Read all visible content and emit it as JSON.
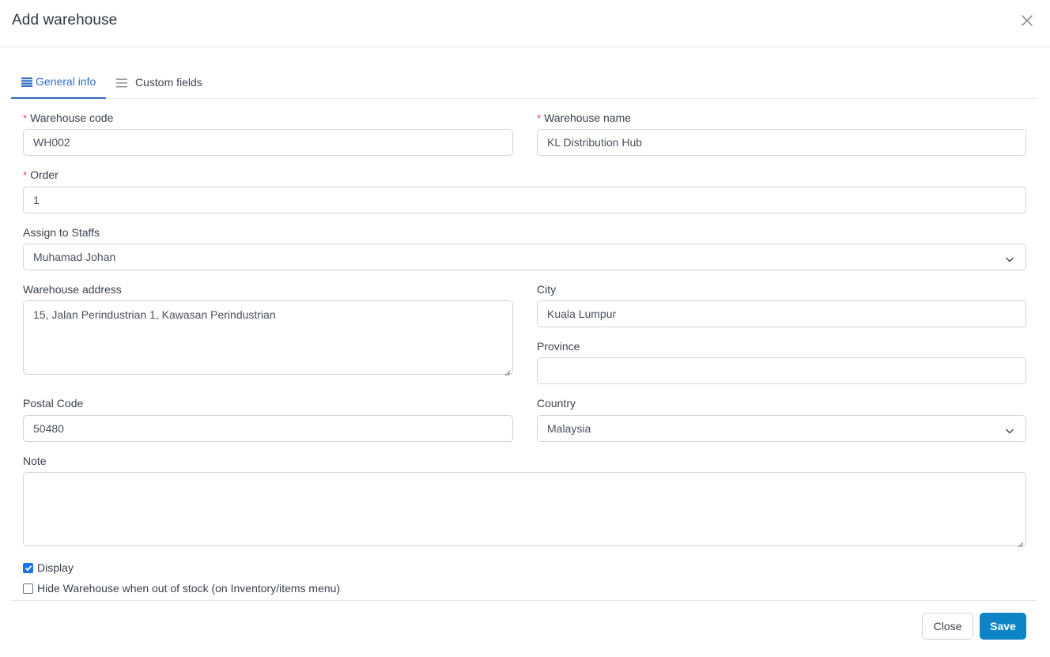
{
  "modal": {
    "title": "Add warehouse",
    "close_icon": "close-icon"
  },
  "tabs": [
    {
      "label": "General info",
      "icon": "list-icon",
      "active": true
    },
    {
      "label": "Custom fields",
      "icon": "bars-icon",
      "active": false
    }
  ],
  "form": {
    "warehouse_code": {
      "label": "Warehouse code",
      "required": "*",
      "value": "WH002"
    },
    "warehouse_name": {
      "label": "Warehouse name",
      "required": "*",
      "value": "KL Distribution Hub"
    },
    "order": {
      "label": "Order",
      "required": "*",
      "value": "1"
    },
    "assign_to_staffs": {
      "label": "Assign to Staffs",
      "value": "Muhamad Johan"
    },
    "warehouse_address": {
      "label": "Warehouse address",
      "value": "15, Jalan Perindustrian 1, Kawasan Perindustrian"
    },
    "city": {
      "label": "City",
      "value": "Kuala Lumpur"
    },
    "province": {
      "label": "Province",
      "value": ""
    },
    "postal_code": {
      "label": "Postal Code",
      "value": "50480"
    },
    "country": {
      "label": "Country",
      "value": "Malaysia"
    },
    "note": {
      "label": "Note",
      "value": ""
    },
    "display": {
      "label": "Display",
      "checked": true
    },
    "hide_when_out_of_stock": {
      "label": "Hide Warehouse when out of stock (on Inventory/items menu)",
      "checked": false
    }
  },
  "footer": {
    "close_label": "Close",
    "save_label": "Save"
  },
  "colors": {
    "accent": "#2f6cc4",
    "primary_button": "#0d84c8",
    "required": "#e2434b",
    "checkbox": "#1a73e8"
  }
}
